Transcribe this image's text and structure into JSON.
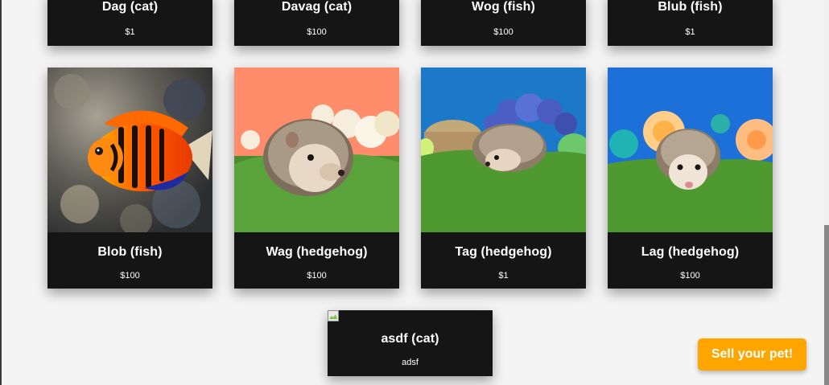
{
  "pets": [
    {
      "name": "Dag (cat)",
      "price": "$1"
    },
    {
      "name": "Davag (cat)",
      "price": "$100"
    },
    {
      "name": "Wog (fish)",
      "price": "$100"
    },
    {
      "name": "Blub (fish)",
      "price": "$1"
    },
    {
      "name": "Blob (fish)",
      "price": "$100"
    },
    {
      "name": "Wag (hedgehog)",
      "price": "$100"
    },
    {
      "name": "Tag (hedgehog)",
      "price": "$1"
    },
    {
      "name": "Lag (hedgehog)",
      "price": "$100"
    },
    {
      "name": "asdf (cat)",
      "price": "adsf"
    }
  ],
  "sell_button": {
    "label": "Sell your pet!"
  },
  "colors": {
    "card_bg": "#151515",
    "accent": "#ffa500",
    "page_bg": "#f4f4f4"
  }
}
